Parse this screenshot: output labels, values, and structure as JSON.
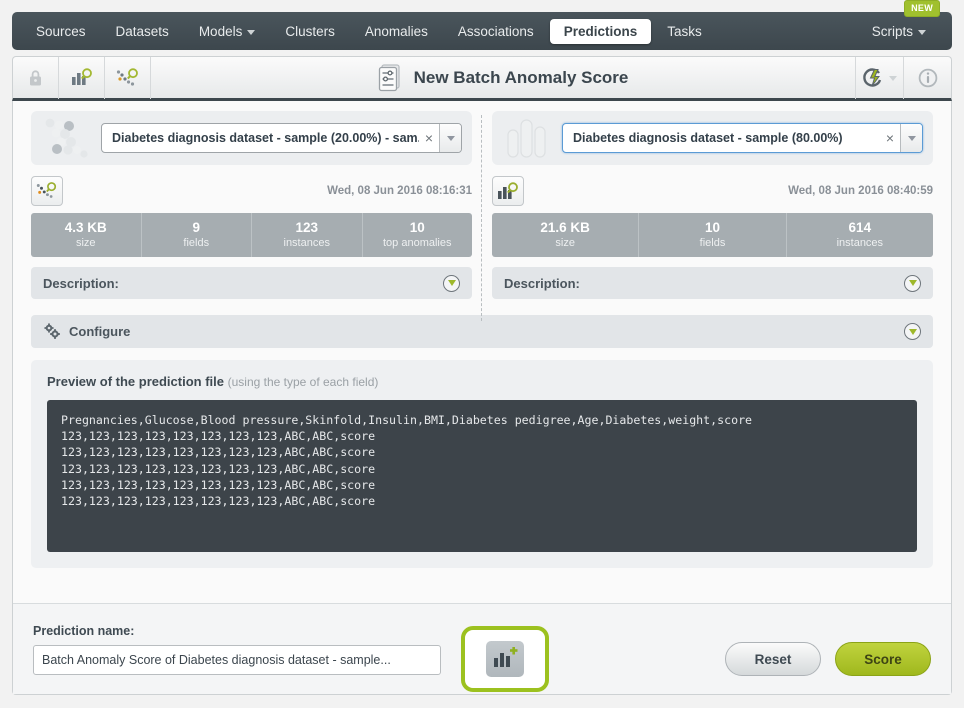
{
  "nav": {
    "items": [
      {
        "label": "Sources",
        "dropdown": false,
        "active": false
      },
      {
        "label": "Datasets",
        "dropdown": false,
        "active": false
      },
      {
        "label": "Models",
        "dropdown": true,
        "active": false
      },
      {
        "label": "Clusters",
        "dropdown": false,
        "active": false
      },
      {
        "label": "Anomalies",
        "dropdown": false,
        "active": false
      },
      {
        "label": "Associations",
        "dropdown": false,
        "active": false
      },
      {
        "label": "Predictions",
        "dropdown": false,
        "active": true
      },
      {
        "label": "Tasks",
        "dropdown": false,
        "active": false
      }
    ],
    "scripts_label": "Scripts",
    "new_badge": "NEW"
  },
  "header": {
    "title": "New Batch Anomaly Score",
    "lock_icon": "lock-icon",
    "dataset_icon": "dataset-search-icon",
    "anomaly_icon": "anomaly-search-icon",
    "title_icon": "batch-prediction-icon",
    "action_icon": "lightning-recycle-icon",
    "info_icon": "info-icon"
  },
  "left_panel": {
    "source_icon": "anomaly-dots-icon",
    "selected_value": "Diabetes diagnosis dataset - sample (20.00%) - sam..",
    "clear_label": "×",
    "resource_icon": "anomaly-detection-icon",
    "date": "Wed, 08 Jun 2016 08:16:31",
    "stats": [
      {
        "value": "4.3 KB",
        "label": "size"
      },
      {
        "value": "9",
        "label": "fields"
      },
      {
        "value": "123",
        "label": "instances"
      },
      {
        "value": "10",
        "label": "top anomalies"
      }
    ],
    "description_label": "Description:"
  },
  "right_panel": {
    "source_icon": "bar-chart-icon",
    "selected_value": "Diabetes diagnosis dataset - sample (80.00%)",
    "clear_label": "×",
    "resource_icon": "dataset-search-icon",
    "date": "Wed, 08 Jun 2016 08:40:59",
    "stats": [
      {
        "value": "21.6 KB",
        "label": "size"
      },
      {
        "value": "10",
        "label": "fields"
      },
      {
        "value": "614",
        "label": "instances"
      }
    ],
    "description_label": "Description:"
  },
  "configure": {
    "label": "Configure",
    "icon": "gears-icon"
  },
  "preview": {
    "title": "Preview of the prediction file",
    "subtitle": "(using the type of each field)",
    "code": "Pregnancies,Glucose,Blood pressure,Skinfold,Insulin,BMI,Diabetes pedigree,Age,Diabetes,weight,score\n123,123,123,123,123,123,123,123,ABC,ABC,score\n123,123,123,123,123,123,123,123,ABC,ABC,score\n123,123,123,123,123,123,123,123,ABC,ABC,score\n123,123,123,123,123,123,123,123,ABC,ABC,score\n123,123,123,123,123,123,123,123,ABC,ABC,score"
  },
  "bottom": {
    "prediction_name_label": "Prediction name:",
    "prediction_name_value": "Batch Anomaly Score of Diabetes diagnosis dataset - sample...",
    "prediction_name_placeholder": "Prediction name",
    "create_dataset_icon": "create-dataset-icon",
    "reset_label": "Reset",
    "score_label": "Score"
  },
  "colors": {
    "nav_bg": "#3d474d",
    "accent_green": "#9fb81d",
    "highlight_green": "#9cc11f",
    "stats_bg": "#a6adb1",
    "code_bg": "#3d444a"
  }
}
